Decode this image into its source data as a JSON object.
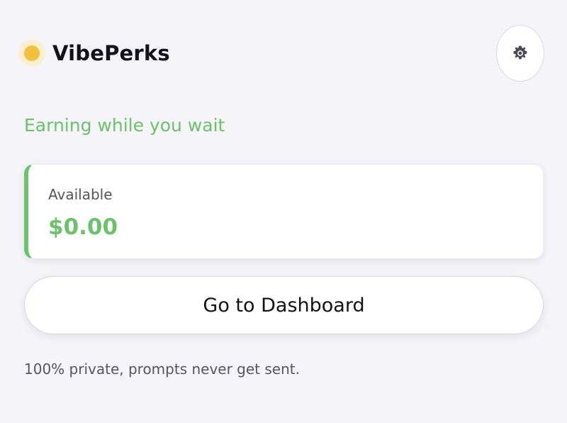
{
  "header": {
    "brand_name": "VibePerks",
    "status_color": "#f2c03e",
    "settings_icon": "gear-icon"
  },
  "main": {
    "tagline": "Earning while you wait",
    "balance": {
      "label": "Available",
      "value": "$0.00"
    },
    "dashboard_button_label": "Go to Dashboard",
    "footer_note": "100% private, prompts never get sent."
  },
  "colors": {
    "accent_green": "#6cc26a",
    "status_yellow": "#f2c03e",
    "background": "#f4f4f9"
  }
}
